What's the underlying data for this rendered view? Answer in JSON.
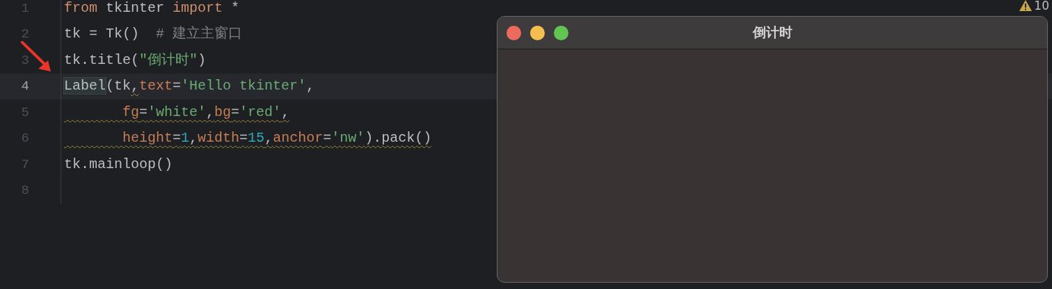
{
  "editor": {
    "lines": [
      {
        "number": "1",
        "current": false,
        "tokens": [
          {
            "text": "from",
            "kind": "keyword",
            "squiggle": false
          },
          {
            "text": " tkinter ",
            "kind": "plain",
            "squiggle": false
          },
          {
            "text": "import",
            "kind": "keyword",
            "squiggle": false
          },
          {
            "text": " *",
            "kind": "plain",
            "squiggle": false
          }
        ]
      },
      {
        "number": "2",
        "current": false,
        "tokens": [
          {
            "text": "tk = Tk()  ",
            "kind": "plain",
            "squiggle": false
          },
          {
            "text": "# 建立主窗口",
            "kind": "comment",
            "squiggle": false
          }
        ]
      },
      {
        "number": "3",
        "current": false,
        "tokens": [
          {
            "text": "tk.title(",
            "kind": "plain",
            "squiggle": false
          },
          {
            "text": "\"倒计时\"",
            "kind": "string",
            "squiggle": false
          },
          {
            "text": ")",
            "kind": "plain",
            "squiggle": false
          }
        ]
      },
      {
        "number": "4",
        "current": true,
        "tokens": [
          {
            "text": "Label",
            "kind": "match",
            "squiggle": false
          },
          {
            "text": "(tk",
            "kind": "plain",
            "squiggle": false
          },
          {
            "text": ",",
            "kind": "plain",
            "squiggle": true
          },
          {
            "text": "text",
            "kind": "param",
            "squiggle": false
          },
          {
            "text": "=",
            "kind": "plain",
            "squiggle": false
          },
          {
            "text": "'Hello tkinter'",
            "kind": "string",
            "squiggle": false
          },
          {
            "text": ",",
            "kind": "plain",
            "squiggle": false
          }
        ]
      },
      {
        "number": "5",
        "current": false,
        "indented": true,
        "tokens": [
          {
            "text": "fg",
            "kind": "param",
            "squiggle": true
          },
          {
            "text": "=",
            "kind": "plain",
            "squiggle": true
          },
          {
            "text": "'white'",
            "kind": "string",
            "squiggle": true
          },
          {
            "text": ",",
            "kind": "plain",
            "squiggle": true
          },
          {
            "text": "bg",
            "kind": "param",
            "squiggle": true
          },
          {
            "text": "=",
            "kind": "plain",
            "squiggle": true
          },
          {
            "text": "'red'",
            "kind": "string",
            "squiggle": true
          },
          {
            "text": ",",
            "kind": "plain",
            "squiggle": true
          }
        ]
      },
      {
        "number": "6",
        "current": false,
        "indented": true,
        "tokens": [
          {
            "text": "height",
            "kind": "param",
            "squiggle": true
          },
          {
            "text": "=",
            "kind": "plain",
            "squiggle": true
          },
          {
            "text": "1",
            "kind": "number",
            "squiggle": true
          },
          {
            "text": ",",
            "kind": "plain",
            "squiggle": true
          },
          {
            "text": "width",
            "kind": "param",
            "squiggle": true
          },
          {
            "text": "=",
            "kind": "plain",
            "squiggle": true
          },
          {
            "text": "15",
            "kind": "number",
            "squiggle": true
          },
          {
            "text": ",",
            "kind": "plain",
            "squiggle": true
          },
          {
            "text": "anchor",
            "kind": "param",
            "squiggle": true
          },
          {
            "text": "=",
            "kind": "plain",
            "squiggle": true
          },
          {
            "text": "'nw'",
            "kind": "string",
            "squiggle": true
          },
          {
            "text": ").pack()",
            "kind": "plain",
            "squiggle": true
          }
        ]
      },
      {
        "number": "7",
        "current": false,
        "tokens": [
          {
            "text": "tk.mainloop()",
            "kind": "plain",
            "squiggle": false
          }
        ]
      },
      {
        "number": "8",
        "current": false
      }
    ],
    "warnings": {
      "count": "10"
    }
  },
  "window": {
    "title": "倒计时"
  }
}
